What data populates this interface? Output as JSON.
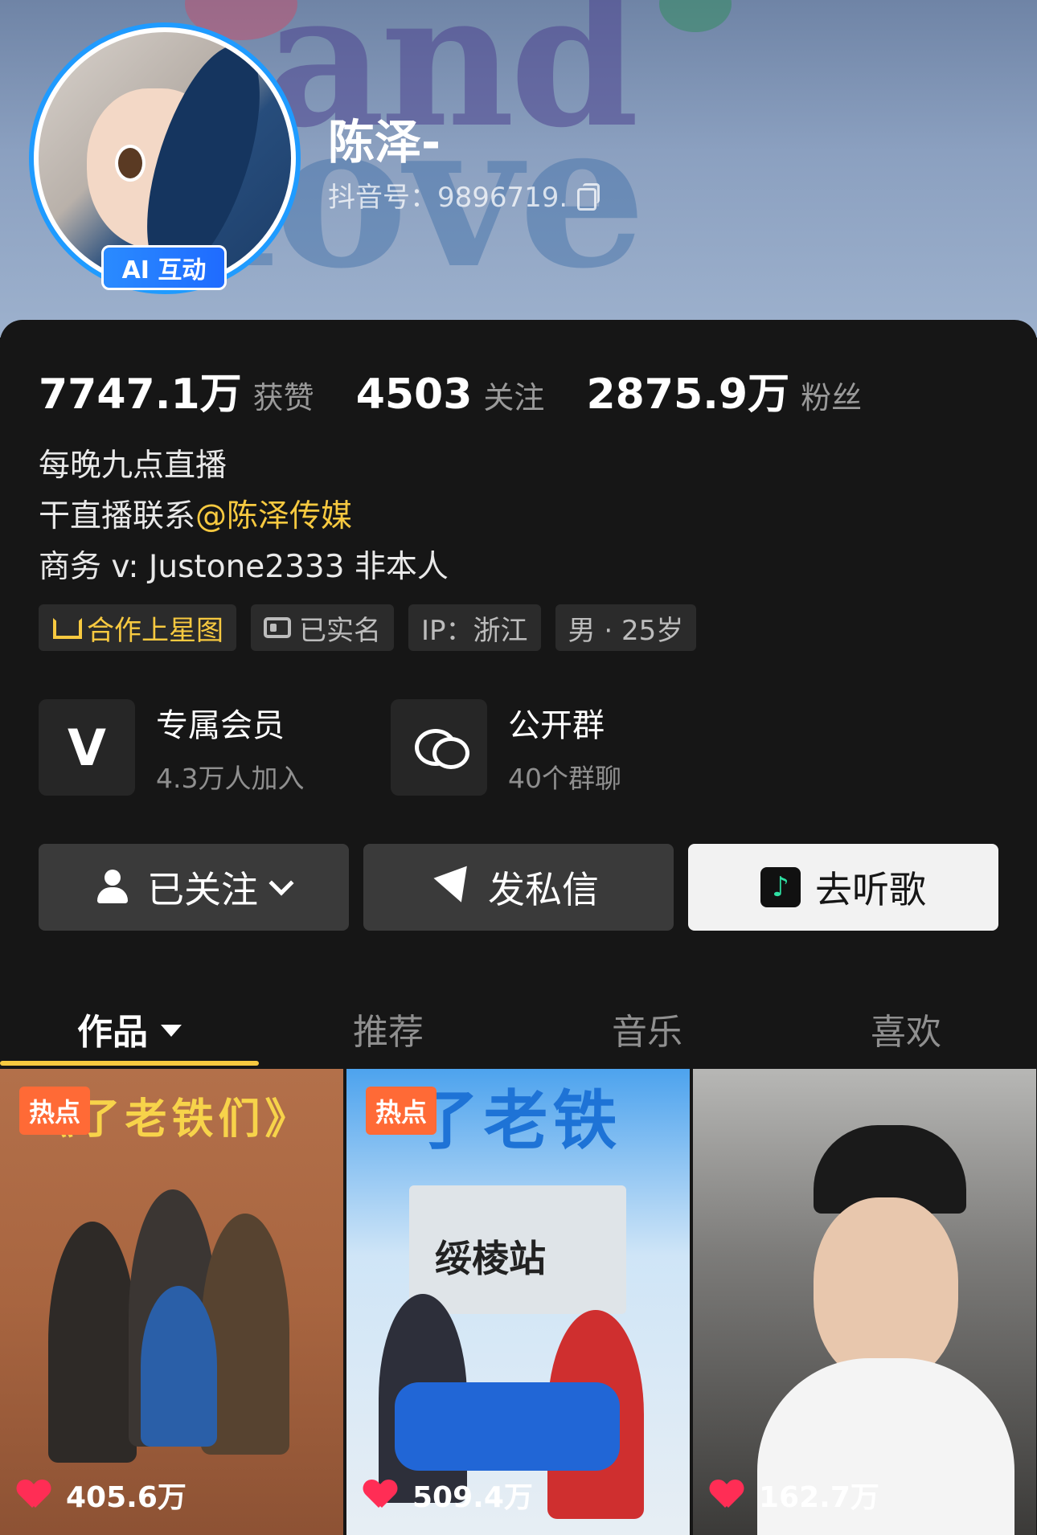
{
  "profile": {
    "nickname": "陈泽-",
    "douyin_id": "抖音号：9896719.",
    "ai_badge": "AI 互动"
  },
  "stats": [
    {
      "value": "7747.1万",
      "label": "获赞"
    },
    {
      "value": "4503",
      "label": "关注"
    },
    {
      "value": "2875.9万",
      "label": "粉丝"
    }
  ],
  "bio": {
    "line1": "每晚九点直播",
    "line2_prefix": "干直播联系",
    "line2_mention": "@陈泽传媒",
    "line3": "商务 v: Justone2333 非本人"
  },
  "tags": [
    "合作上星图",
    "已实名",
    "IP：浙江",
    "男 · 25岁"
  ],
  "cards": [
    {
      "title": "专属会员",
      "subtitle": "4.3万人加入",
      "icon": "v-icon"
    },
    {
      "title": "公开群",
      "subtitle": "40个群聊",
      "icon": "chat-bubbles-icon"
    }
  ],
  "actions": {
    "follow": "已关注",
    "message": "发私信",
    "music": "去听歌"
  },
  "tabs": [
    "作品",
    "推荐",
    "音乐",
    "喜欢"
  ],
  "videos": [
    {
      "badge": "热点",
      "banner": "《了老铁们》",
      "likes": "405.6万"
    },
    {
      "badge": "热点",
      "banner": "了老铁",
      "sign": "绥棱站",
      "likes": "509.4万"
    },
    {
      "likes": "162.7万"
    }
  ],
  "colors": {
    "background": "#161616",
    "accent_yellow": "#f7c940",
    "ai_badge_blue": "#1f6bff",
    "hot_orange": "#ff6a36",
    "like_red": "#ff2d55"
  }
}
